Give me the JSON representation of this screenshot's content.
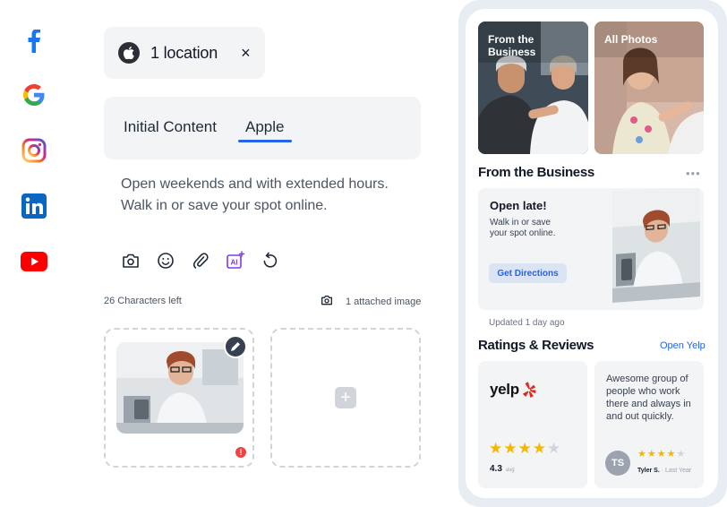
{
  "composer": {
    "location_chip": {
      "label": "1 location",
      "close_symbol": "×"
    },
    "tabs": [
      {
        "label": "Initial Content",
        "active": false
      },
      {
        "label": "Apple",
        "active": true
      }
    ],
    "body_text": "Open weekends and with extended hours. Walk in or save your spot online.",
    "toolbar_icons": [
      "camera-icon",
      "emoji-icon",
      "attachment-icon",
      "ai-icon",
      "undo-icon"
    ],
    "chars_left": "26 Characters left",
    "attached_text": "1 attached image",
    "warning_symbol": "!",
    "add_symbol": "+"
  },
  "social_networks": [
    "facebook",
    "google",
    "instagram",
    "linkedin",
    "youtube"
  ],
  "preview": {
    "photos": [
      {
        "label": "From the Business"
      },
      {
        "label": "All Photos"
      }
    ],
    "from_business": {
      "title": "From the Business",
      "more": "•••",
      "card_title": "Open late!",
      "card_text": "Walk in or save your spot online.",
      "button_label": "Get Directions",
      "updated": "Updated 1 day ago"
    },
    "ratings": {
      "title": "Ratings & Reviews",
      "link": "Open Yelp",
      "yelp_wordmark": "yelp",
      "rating_value": "4.3",
      "rating_suffix": "avg",
      "stars_filled": 4,
      "stars_total": 5,
      "review_text": "Awesome group of people who work there and always in and out quickly.",
      "reviewer_initials": "TS",
      "reviewer_name": "Tyler S.",
      "reviewer_time": "· Last Year",
      "reviewer_stars": 4
    }
  },
  "colors": {
    "accent_blue": "#2563eb",
    "star_yellow": "#f6b600",
    "yelp_red": "#e0271a"
  }
}
